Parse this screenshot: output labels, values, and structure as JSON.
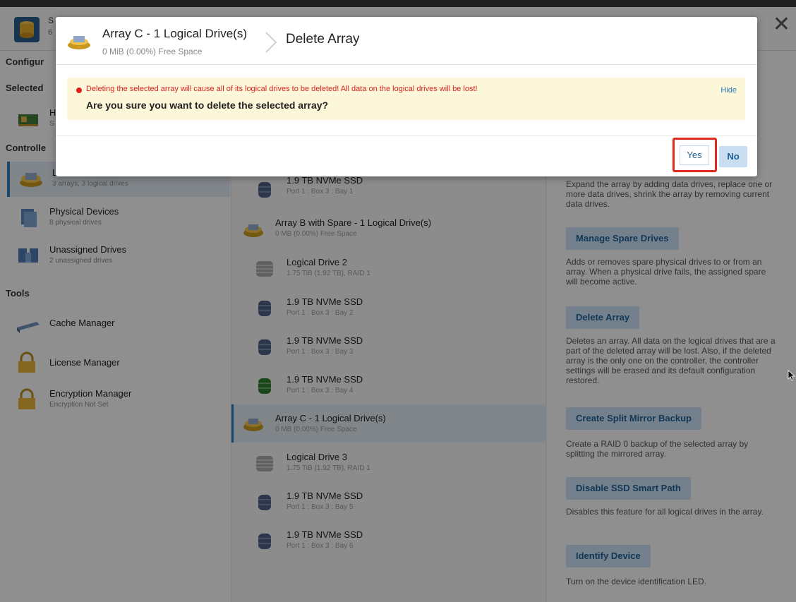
{
  "app_header": {
    "title": "S",
    "subtitle": "6"
  },
  "sidebar": {
    "configure_label": "Configur",
    "selected_label": "Selected",
    "selected_item_initial": "H",
    "selected_item_sub_initial": "S",
    "controller_label": "Controlle",
    "items": [
      {
        "title": "L",
        "sub": "3 arrays, 3 logical drives"
      },
      {
        "title": "Physical Devices",
        "sub": "8 physical drives"
      },
      {
        "title": "Unassigned Drives",
        "sub": "2 unassigned drives"
      }
    ],
    "tools_label": "Tools",
    "tools": [
      {
        "title": "Cache Manager",
        "sub": ""
      },
      {
        "title": "License Manager",
        "sub": ""
      },
      {
        "title": "Encryption Manager",
        "sub": "Encryption Not Set"
      }
    ]
  },
  "middle": {
    "rows": [
      {
        "title": "1.9 TB NVMe SSD",
        "sub": "Port 1 : Box 3 : Bay 1"
      },
      {
        "title": "Array B with Spare - 1 Logical Drive(s)",
        "sub": "0 MB (0.00%) Free Space"
      },
      {
        "title": "Logical Drive 2",
        "sub": "1.75 TiB (1.92 TB), RAID 1"
      },
      {
        "title": "1.9 TB NVMe SSD",
        "sub": "Port 1 : Box 3 : Bay 2"
      },
      {
        "title": "1.9 TB NVMe SSD",
        "sub": "Port 1 : Box 3 : Bay 3"
      },
      {
        "title": "1.9 TB NVMe SSD",
        "sub": "Port 1 : Box 3 : Bay 4"
      },
      {
        "title": "Array C - 1 Logical Drive(s)",
        "sub": "0 MB (0.00%) Free Space"
      },
      {
        "title": "Logical Drive 3",
        "sub": "1.75 TiB (1.92 TB), RAID 1"
      },
      {
        "title": "1.9 TB NVMe SSD",
        "sub": "Port 1 : Box 3 : Bay 5"
      },
      {
        "title": "1.9 TB NVMe SSD",
        "sub": "Port 1 : Box 3 : Bay 6"
      }
    ]
  },
  "right": {
    "expand_desc": "Expand the array by adding data drives, replace one or more data drives, shrink the array by removing current data drives.",
    "actions": [
      {
        "label": "Manage Spare Drives",
        "desc": "Adds or removes spare physical drives to or from an array. When a physical drive fails, the assigned spare will become active."
      },
      {
        "label": "Delete Array",
        "desc": "Deletes an array. All data on the logical drives that are a part of the deleted array will be lost. Also, if the deleted array is the only one on the controller, the controller settings will be erased and its default configuration restored."
      },
      {
        "label": "Create Split Mirror Backup",
        "desc": "Create a RAID 0 backup of the selected array by splitting the mirrored array."
      },
      {
        "label": "Disable SSD Smart Path",
        "desc": "Disables this feature for all logical drives in the array."
      },
      {
        "label": "Identify Device",
        "desc": "Turn on the device identification LED."
      }
    ]
  },
  "modal": {
    "crumb_title": "Array C - 1 Logical Drive(s)",
    "crumb_sub": "0 MiB (0.00%) Free Space",
    "title": "Delete Array",
    "warning": "Deleting the selected array will cause all of its logical drives to be deleted! All data on the logical drives will be lost!",
    "question": "Are you sure you want to delete the selected array?",
    "hide_label": "Hide",
    "yes_label": "Yes",
    "no_label": "No"
  },
  "colors": {
    "accent": "#2b7bb9",
    "warning": "#e02020",
    "highlight_border": "#e02a1e"
  }
}
